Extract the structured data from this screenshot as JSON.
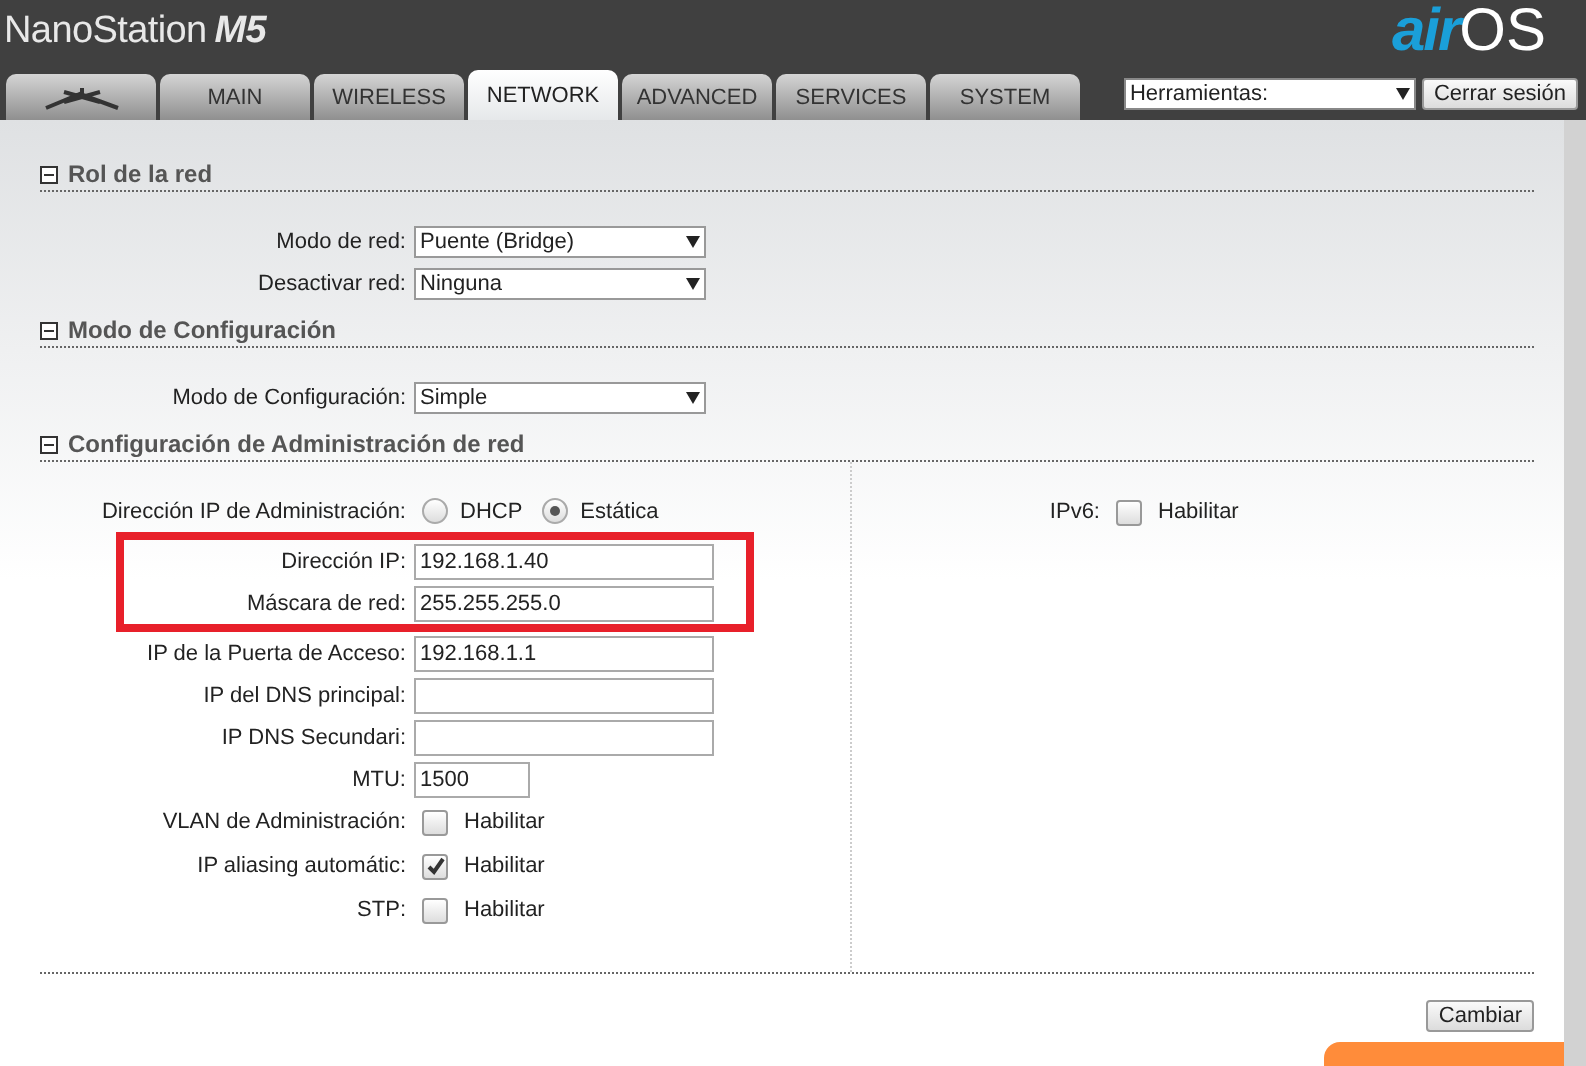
{
  "header": {
    "product": "NanoStation",
    "model": "M5",
    "brand_prefix": "air",
    "brand_suffix": "OS"
  },
  "tabs": [
    {
      "kind": "logo",
      "selected": false
    },
    {
      "kind": "text",
      "label": "MAIN",
      "selected": false
    },
    {
      "kind": "text",
      "label": "WIRELESS",
      "selected": false
    },
    {
      "kind": "text",
      "label": "NETWORK",
      "selected": true
    },
    {
      "kind": "text",
      "label": "ADVANCED",
      "selected": false
    },
    {
      "kind": "text",
      "label": "SERVICES",
      "selected": false
    },
    {
      "kind": "text",
      "label": "SYSTEM",
      "selected": false
    }
  ],
  "tools": {
    "dropdown": "Herramientas:",
    "logout": "Cerrar sesión"
  },
  "sections": [
    {
      "title": "Rol de la red",
      "expanded": true,
      "fields": [
        {
          "kind": "select",
          "label": "Modo de red:",
          "value": "Puente (Bridge)"
        },
        {
          "kind": "select",
          "label": "Desactivar red:",
          "value": "Ninguna"
        }
      ]
    },
    {
      "title": "Modo de Configuración",
      "expanded": true,
      "fields": [
        {
          "kind": "select",
          "label": "Modo de Configuración:",
          "value": "Simple"
        }
      ]
    },
    {
      "title": "Configuración de Administración de red",
      "expanded": true,
      "fields": [
        {
          "kind": "radio",
          "label": "Dirección IP de Administración:",
          "options": [
            {
              "label": "DHCP",
              "selected": false
            },
            {
              "label": "Estática",
              "selected": true
            }
          ]
        },
        {
          "kind": "text",
          "label": "Dirección IP:",
          "value": "192.168.1.40",
          "highlighted": true
        },
        {
          "kind": "text",
          "label": "Máscara de red:",
          "value": "255.255.255.0",
          "highlighted": true
        },
        {
          "kind": "text",
          "label": "IP de la Puerta de Acceso:",
          "value": "192.168.1.1",
          "highlighted": false
        },
        {
          "kind": "text",
          "label": "IP del DNS principal:",
          "highlighted": false
        },
        {
          "kind": "text",
          "label": "IP DNS Secundari:",
          "highlighted": false
        },
        {
          "kind": "short",
          "label": "MTU:",
          "value": "1500",
          "highlighted": false
        },
        {
          "kind": "checkbox",
          "label": "VLAN de Administración:",
          "text": "Habilitar",
          "checked": false
        },
        {
          "kind": "checkbox",
          "label": "IP aliasing automátic:",
          "text": "Habilitar",
          "checked": true
        },
        {
          "kind": "checkbox",
          "label": "STP:",
          "text": "Habilitar",
          "checked": false
        }
      ],
      "side_fields": [
        {
          "kind": "checkbox",
          "label": "IPv6:",
          "text": "Habilitar",
          "checked": false
        }
      ]
    }
  ],
  "submit": "Cambiar"
}
